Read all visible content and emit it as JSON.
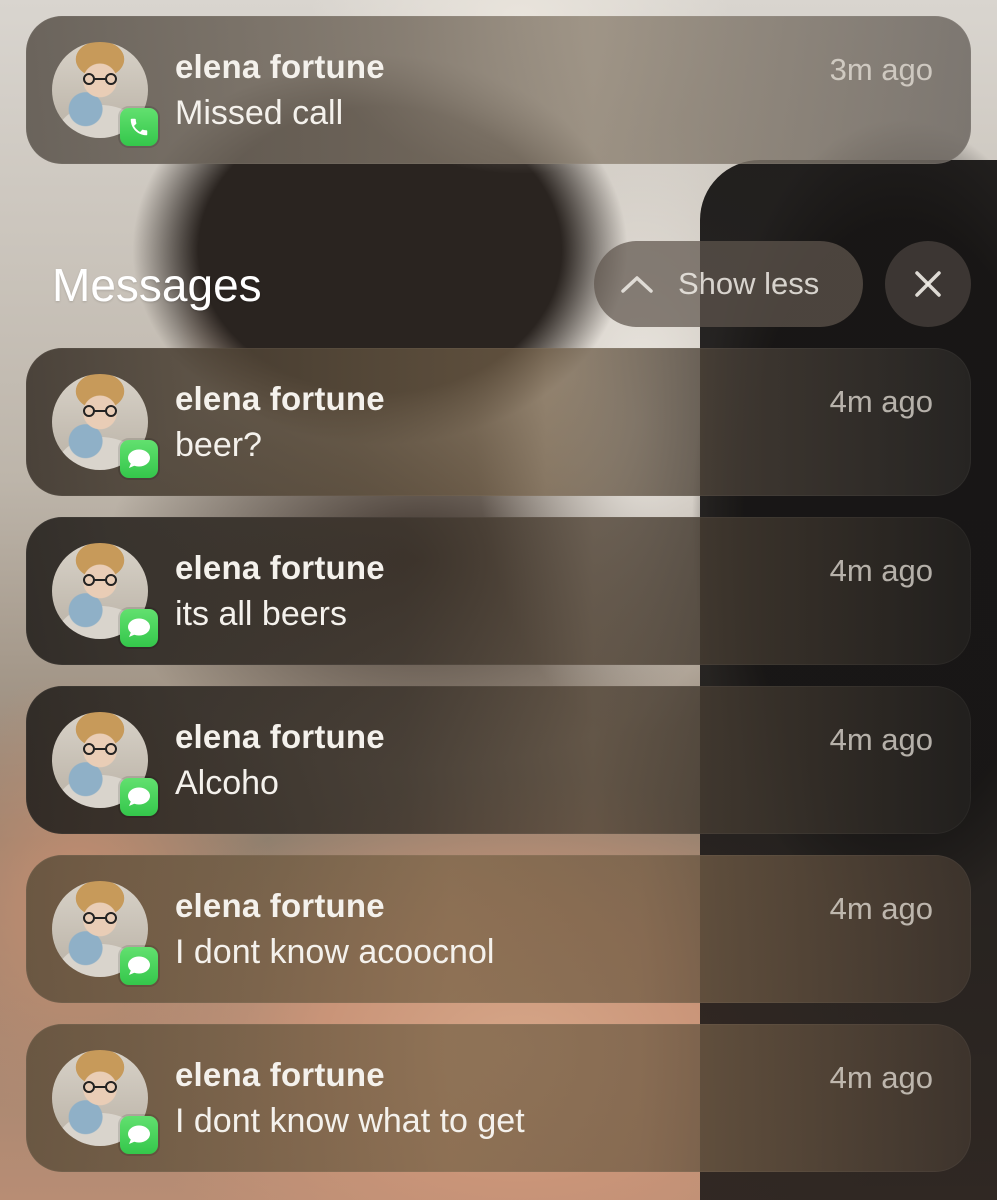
{
  "top_notification": {
    "sender": "elena fortune",
    "message": "Missed call",
    "time": "3m ago",
    "app_icon": "phone-icon"
  },
  "group": {
    "title": "Messages",
    "show_less_label": "Show less",
    "show_less_icon": "chevron-up-icon",
    "close_icon": "close-icon"
  },
  "messages": [
    {
      "sender": "elena fortune",
      "message": "beer?",
      "time": "4m ago",
      "app_icon": "messages-icon"
    },
    {
      "sender": "elena fortune",
      "message": "its all beers",
      "time": "4m ago",
      "app_icon": "messages-icon"
    },
    {
      "sender": "elena fortune",
      "message": "Alcoho",
      "time": "4m ago",
      "app_icon": "messages-icon"
    },
    {
      "sender": "elena fortune",
      "message": "I dont know acoocnol",
      "time": "4m ago",
      "app_icon": "messages-icon"
    },
    {
      "sender": "elena fortune",
      "message": "I dont know what to get",
      "time": "4m ago",
      "app_icon": "messages-icon"
    }
  ],
  "colors": {
    "badge_green": "#34c74b",
    "text_primary": "#f4f1ec",
    "text_secondary": "#d8d2c8"
  }
}
